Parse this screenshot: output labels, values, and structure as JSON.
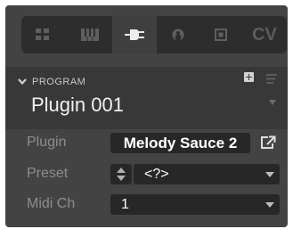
{
  "tabs": {
    "items": [
      {
        "icon": "grid-icon",
        "active": false
      },
      {
        "icon": "keyboard-icon",
        "active": false
      },
      {
        "icon": "plug-icon",
        "active": true
      },
      {
        "icon": "mood-icon",
        "active": false
      },
      {
        "icon": "square-icon",
        "active": false
      },
      {
        "icon": "cv-icon",
        "label": "CV",
        "active": false
      }
    ]
  },
  "program": {
    "section_label": "PROGRAM",
    "name": "Plugin 001"
  },
  "rows": {
    "plugin": {
      "label": "Plugin",
      "value": "Melody Sauce 2"
    },
    "preset": {
      "label": "Preset",
      "value": "<?>"
    },
    "midi": {
      "label": "Midi Ch",
      "value": "1"
    }
  },
  "colors": {
    "panel_bg": "#434343",
    "tabbar_bg": "#2d2d2d",
    "field_bg": "#272727",
    "label_text": "#8d8d8d",
    "value_text": "#ffffff"
  }
}
